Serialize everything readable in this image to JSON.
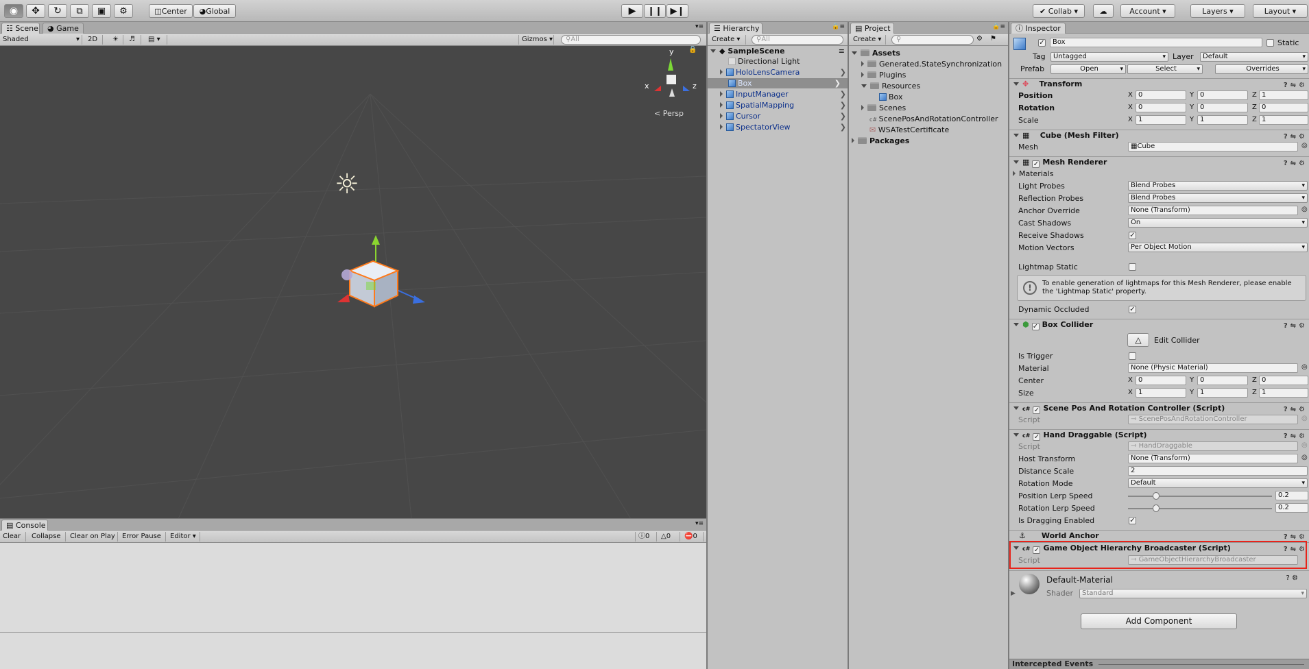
{
  "toolbar": {
    "pivot": "Center",
    "space": "Global",
    "collab": "Collab",
    "account": "Account",
    "layers": "Layers",
    "layout": "Layout"
  },
  "scene": {
    "tab_scene": "Scene",
    "tab_game": "Game",
    "shading": "Shaded",
    "mode2d": "2D",
    "gizmos": "Gizmos",
    "search_placeholder": "All",
    "persp": "Persp",
    "axis_x": "x",
    "axis_y": "y",
    "axis_z": "z"
  },
  "console": {
    "tab": "Console",
    "clear": "Clear",
    "collapse": "Collapse",
    "clear_on_play": "Clear on Play",
    "error_pause": "Error Pause",
    "editor": "Editor",
    "count_info": "0",
    "count_warn": "0",
    "count_error": "0"
  },
  "hierarchy": {
    "tab": "Hierarchy",
    "create": "Create",
    "search_placeholder": "All",
    "scene": "SampleScene",
    "items": [
      {
        "label": "Directional Light"
      },
      {
        "label": "HoloLensCamera"
      },
      {
        "label": "Box"
      },
      {
        "label": "InputManager"
      },
      {
        "label": "SpatialMapping"
      },
      {
        "label": "Cursor"
      },
      {
        "label": "SpectatorView"
      }
    ]
  },
  "project": {
    "tab": "Project",
    "create": "Create",
    "items": [
      "Assets",
      "Generated.StateSynchronization",
      "Plugins",
      "Resources",
      "Box",
      "Scenes",
      "ScenePosAndRotationController",
      "WSATestCertificate",
      "Packages"
    ]
  },
  "inspector": {
    "tab": "Inspector",
    "object_name": "Box",
    "static_label": "Static",
    "tag_label": "Tag",
    "tag_value": "Untagged",
    "layer_label": "Layer",
    "layer_value": "Default",
    "prefab_label": "Prefab",
    "open": "Open",
    "select": "Select",
    "overrides": "Overrides",
    "transform": {
      "title": "Transform",
      "position": "Position",
      "rotation": "Rotation",
      "scale": "Scale",
      "pos": [
        "0",
        "0",
        "1"
      ],
      "rot": [
        "0",
        "0",
        "0"
      ],
      "scl": [
        "1",
        "1",
        "1"
      ],
      "x": "X",
      "y": "Y",
      "z": "Z"
    },
    "mesh_filter": {
      "title": "Cube (Mesh Filter)",
      "mesh_label": "Mesh",
      "mesh_value": "Cube"
    },
    "mesh_renderer": {
      "title": "Mesh Renderer",
      "materials": "Materials",
      "light_probes": "Light Probes",
      "light_probes_v": "Blend Probes",
      "reflection_probes": "Reflection Probes",
      "reflection_probes_v": "Blend Probes",
      "anchor_override": "Anchor Override",
      "anchor_override_v": "None (Transform)",
      "cast_shadows": "Cast Shadows",
      "cast_shadows_v": "On",
      "receive_shadows": "Receive Shadows",
      "motion_vectors": "Motion Vectors",
      "motion_vectors_v": "Per Object Motion",
      "lightmap_static": "Lightmap Static",
      "info": "To enable generation of lightmaps for this Mesh Renderer, please enable the 'Lightmap Static' property.",
      "dynamic_occluded": "Dynamic Occluded"
    },
    "box_collider": {
      "title": "Box Collider",
      "edit_collider": "Edit Collider",
      "is_trigger": "Is Trigger",
      "material": "Material",
      "material_v": "None (Physic Material)",
      "center": "Center",
      "size": "Size",
      "center_v": [
        "0",
        "0",
        "0"
      ],
      "size_v": [
        "1",
        "1",
        "1"
      ]
    },
    "scene_pos": {
      "title": "Scene Pos And Rotation Controller (Script)",
      "script_label": "Script",
      "script_v": "ScenePosAndRotationController"
    },
    "hand_draggable": {
      "title": "Hand Draggable (Script)",
      "script_label": "Script",
      "script_v": "HandDraggable",
      "host_transform": "Host Transform",
      "host_transform_v": "None (Transform)",
      "distance_scale": "Distance Scale",
      "distance_scale_v": "2",
      "rotation_mode": "Rotation Mode",
      "rotation_mode_v": "Default",
      "pos_lerp": "Position Lerp Speed",
      "pos_lerp_v": "0.2",
      "rot_lerp": "Rotation Lerp Speed",
      "rot_lerp_v": "0.2",
      "is_dragging": "Is Dragging Enabled"
    },
    "world_anchor": {
      "title": "World Anchor"
    },
    "broadcaster": {
      "title": "Game Object Hierarchy Broadcaster (Script)",
      "script_label": "Script",
      "script_v": "GameObjectHierarchyBroadcaster"
    },
    "material": {
      "name": "Default-Material",
      "shader_label": "Shader",
      "shader_v": "Standard"
    },
    "add_component": "Add Component",
    "intercepted": "Intercepted Events"
  }
}
